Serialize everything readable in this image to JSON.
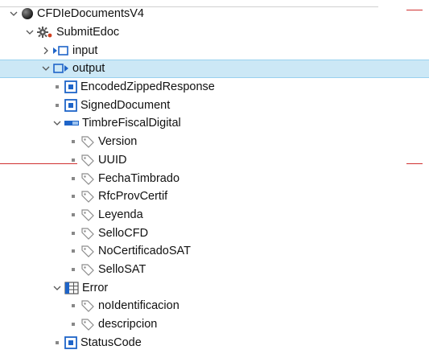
{
  "tree": {
    "root": "CFDIeDocumentsV4",
    "operation": "SubmitEdoc",
    "input": "input",
    "output": "output",
    "encoded_zipped_response": "EncodedZippedResponse",
    "signed_document": "SignedDocument",
    "timbre": "TimbreFiscalDigital",
    "timbre_fields": [
      "Version",
      "UUID",
      "FechaTimbrado",
      "RfcProvCertif",
      "Leyenda",
      "SelloCFD",
      "NoCertificadoSAT",
      "SelloSAT"
    ],
    "error": "Error",
    "error_fields": [
      "noIdentificacion",
      "descripcion"
    ],
    "status_code": "StatusCode"
  },
  "colors": {
    "selection": "#cce8f6",
    "element_icon": "#1e64c8",
    "attribute_icon": "#8c8c8c",
    "guide_line": "#d03030"
  }
}
